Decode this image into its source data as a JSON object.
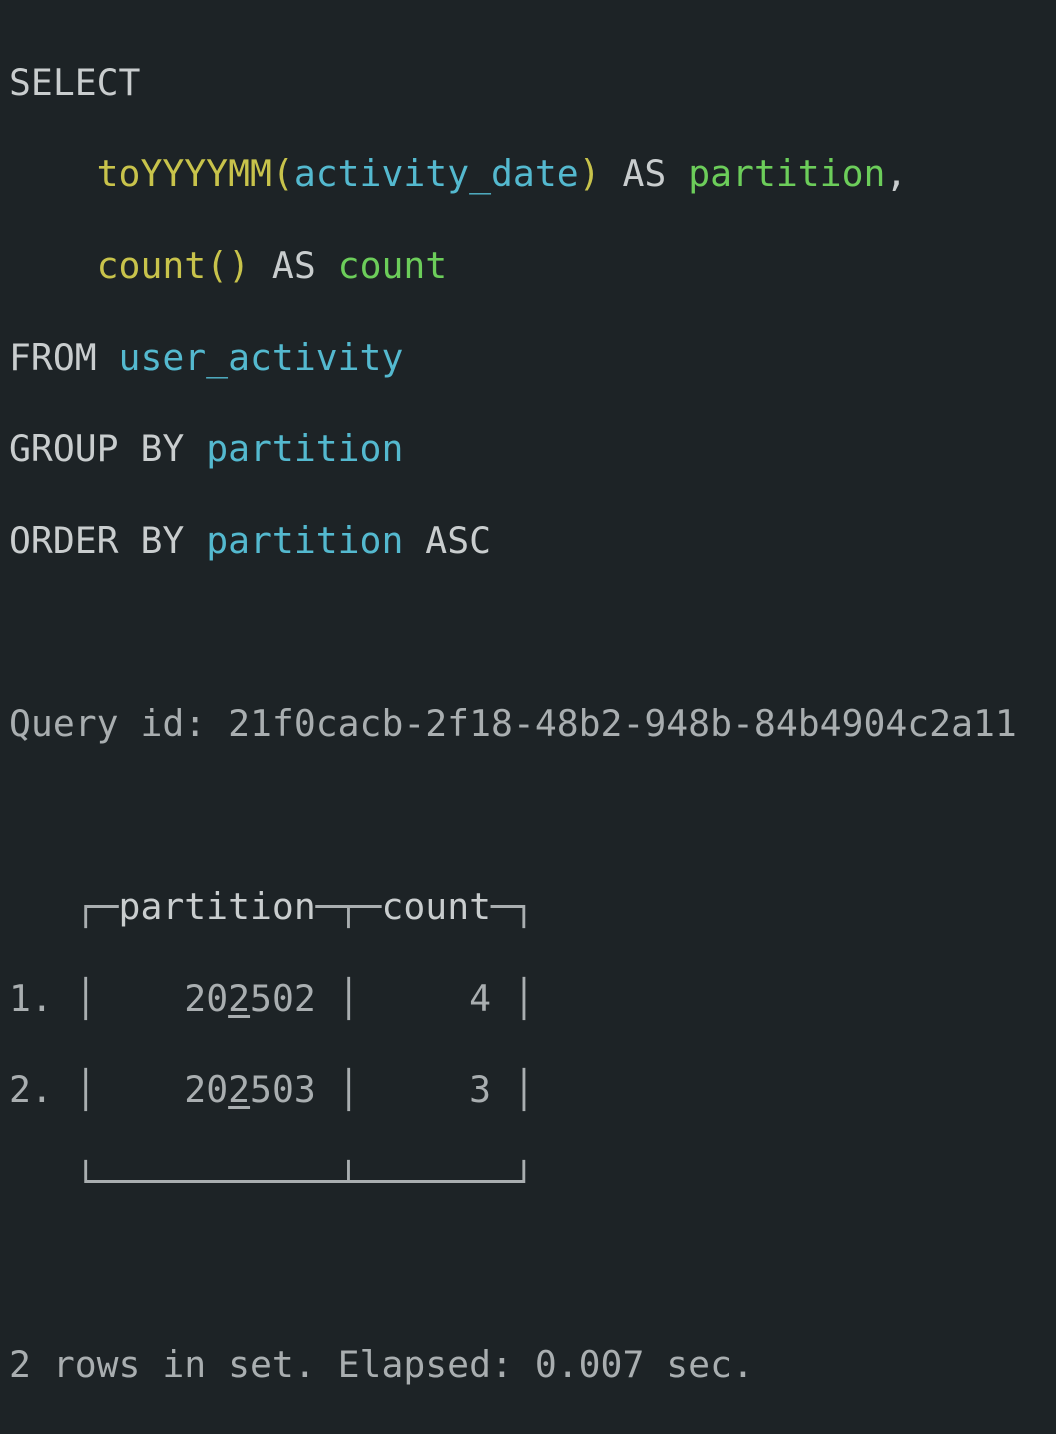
{
  "query": {
    "kw_select": "SELECT",
    "fn_toyyyymm": "toYYYYMM(",
    "arg_activity_date": "activity_date",
    "paren_close": ")",
    "kw_as1": " AS ",
    "alias_partition": "partition",
    "comma": ",",
    "fn_count": "count()",
    "kw_as2": " AS ",
    "alias_count": "count",
    "kw_from": "FROM ",
    "table": "user_activity",
    "kw_group_by": "GROUP BY ",
    "group_col": "partition",
    "kw_order_by": "ORDER BY ",
    "order_col": "partition",
    "kw_asc": " ASC"
  },
  "query_id_label": "Query id: ",
  "query_id": "21f0cacb-2f18-48b2-948b-84b4904c2a11",
  "result": {
    "columns": [
      "partition",
      "count"
    ],
    "rows": [
      {
        "num": "1.",
        "partition_a": "20",
        "partition_b": "2",
        "partition_c": "502",
        "count": "4"
      },
      {
        "num": "2.",
        "partition_a": "20",
        "partition_b": "2",
        "partition_c": "503",
        "count": "3"
      }
    ]
  },
  "footer": "2 rows in set. Elapsed: 0.007 sec."
}
